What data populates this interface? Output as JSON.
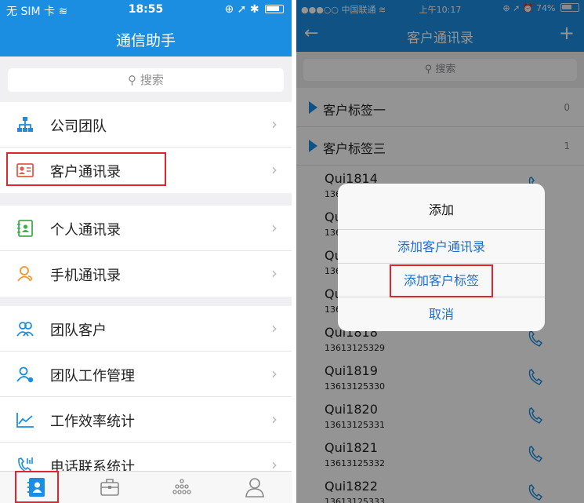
{
  "left_screen": {
    "status_bar": {
      "carrier": "无 SIM 卡",
      "time": "18:55"
    },
    "nav_title": "通信助手",
    "search_placeholder": "搜索",
    "groups": [
      {
        "items": [
          {
            "label": "公司团队",
            "icon": "org-chart-icon"
          },
          {
            "label": "客户通讯录",
            "icon": "contact-card-icon",
            "highlighted": true
          }
        ]
      },
      {
        "items": [
          {
            "label": "个人通讯录",
            "icon": "address-book-icon"
          },
          {
            "label": "手机通讯录",
            "icon": "phone-contacts-icon"
          }
        ]
      },
      {
        "items": [
          {
            "label": "团队客户",
            "icon": "team-customers-icon"
          },
          {
            "label": "团队工作管理",
            "icon": "team-work-icon"
          },
          {
            "label": "工作效率统计",
            "icon": "line-chart-icon"
          },
          {
            "label": "电话联系统计",
            "icon": "phone-stats-icon"
          }
        ]
      }
    ],
    "tabs": [
      {
        "icon": "contacts-tab-icon",
        "active": true
      },
      {
        "icon": "briefcase-tab-icon"
      },
      {
        "icon": "apps-grid-tab-icon"
      },
      {
        "icon": "profile-tab-icon"
      }
    ]
  },
  "right_screen": {
    "status_bar": {
      "carrier": "●●●○○ 中国联通",
      "time": "上午10:17",
      "battery": "74%"
    },
    "nav_title": "客户通讯录",
    "search_placeholder": "搜索",
    "tags": [
      {
        "label": "客户标签一",
        "count": "0"
      },
      {
        "label": "客户标签三",
        "count": "1"
      }
    ],
    "contacts": [
      {
        "name": "Qui1814",
        "phone": "136"
      },
      {
        "name": "Qu",
        "phone": "136"
      },
      {
        "name": "Qu",
        "phone": "136"
      },
      {
        "name": "Qu",
        "phone": "136"
      },
      {
        "name": "Qui1818",
        "phone": "13613125329"
      },
      {
        "name": "Qui1819",
        "phone": "13613125330"
      },
      {
        "name": "Qui1820",
        "phone": "13613125331"
      },
      {
        "name": "Qui1821",
        "phone": "13613125332"
      },
      {
        "name": "Qui1822",
        "phone": "13613125333"
      }
    ],
    "dialog": {
      "title": "添加",
      "options": [
        "添加客户通讯录",
        "添加客户标签",
        "取消"
      ]
    }
  },
  "colors": {
    "brand_blue": "#1b8ee2",
    "highlight_red": "#e0262c",
    "dialog_button": "#1b6fd0"
  }
}
